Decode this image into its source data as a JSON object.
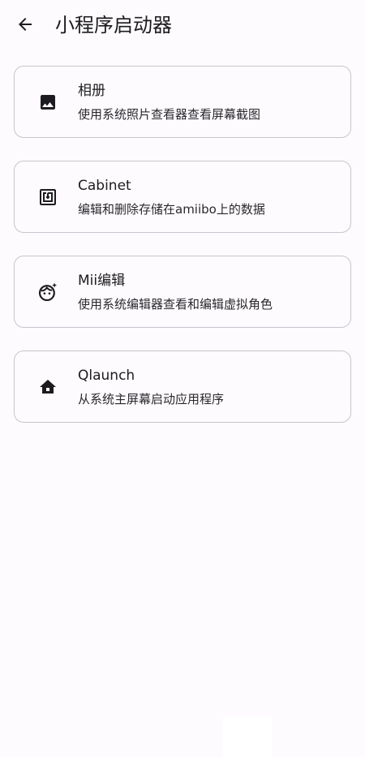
{
  "header": {
    "back_icon": "arrow-back-icon",
    "title": "小程序启动器"
  },
  "colors": {
    "background": "#fdfbfd",
    "card_border": "#cac4cf",
    "text": "#1c1b1f"
  },
  "items": [
    {
      "icon": "image-icon",
      "title": "相册",
      "subtitle": "使用系统照片查看器查看屏幕截图"
    },
    {
      "icon": "nfc-icon",
      "title": "Cabinet",
      "subtitle": "编辑和删除存储在amiibo上的数据"
    },
    {
      "icon": "face-icon",
      "title": "Mii编辑",
      "subtitle": "使用系统编辑器查看和编辑虚拟角色"
    },
    {
      "icon": "home-icon",
      "title": "Qlaunch",
      "subtitle": "从系统主屏幕启动应用程序"
    }
  ]
}
